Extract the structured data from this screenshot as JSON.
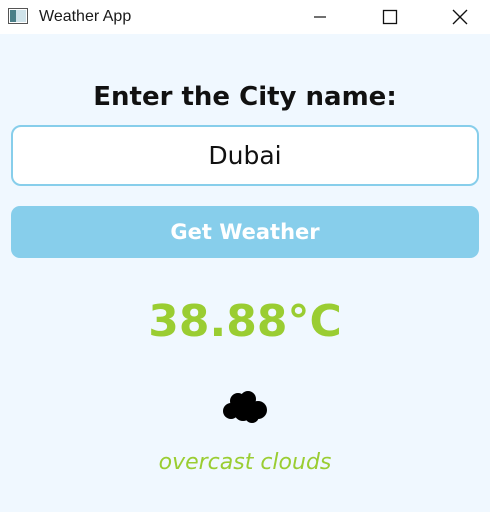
{
  "window": {
    "title": "Weather App"
  },
  "form": {
    "prompt": "Enter the City name:",
    "city_value": "Dubai",
    "button_label": "Get Weather"
  },
  "result": {
    "temperature": "38.88°C",
    "icon": "clouds-icon",
    "description": "overcast clouds"
  },
  "colors": {
    "background": "#f0f8ff",
    "accent": "#87ceeb",
    "result_text": "#9acd32"
  }
}
